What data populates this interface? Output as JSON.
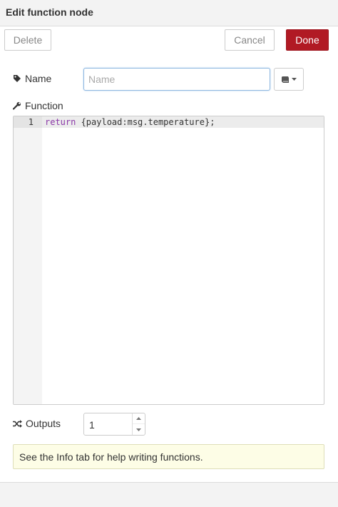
{
  "dialog": {
    "title": "Edit function node"
  },
  "toolbar": {
    "delete_label": "Delete",
    "cancel_label": "Cancel",
    "done_label": "Done"
  },
  "name_field": {
    "label": "Name",
    "placeholder": "Name",
    "value": ""
  },
  "library_button": {
    "icon": "book-icon"
  },
  "function_editor": {
    "label": "Function",
    "lines": [
      {
        "number": "1",
        "keyword": "return",
        "rest": " {payload:msg.temperature};"
      }
    ]
  },
  "outputs": {
    "label": "Outputs",
    "value": "1"
  },
  "tip": {
    "text": "See the Info tab for help writing functions."
  },
  "colors": {
    "primary": "#b11a24",
    "keyword": "#8b38a8",
    "tip_background": "#fdfde6"
  }
}
